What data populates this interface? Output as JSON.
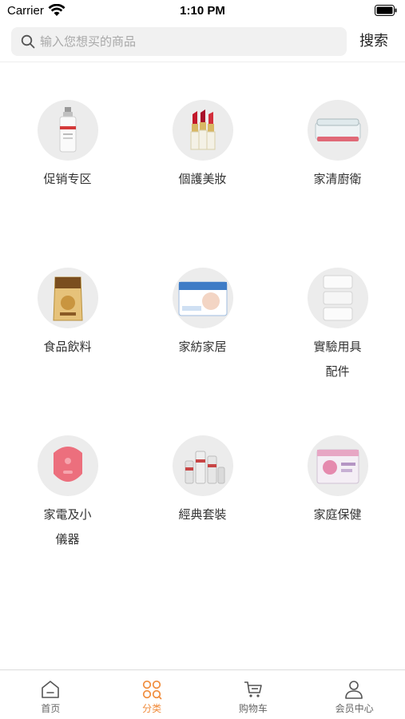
{
  "status_bar": {
    "carrier": "Carrier",
    "time": "1:10 PM"
  },
  "search": {
    "placeholder": "输入您想买的商品",
    "button_label": "搜索"
  },
  "categories": [
    {
      "label": "促销专区",
      "icon": "serum-bottle-icon"
    },
    {
      "label": "個護美妝",
      "icon": "lipstick-icon"
    },
    {
      "label": "家清廚衛",
      "icon": "storage-box-icon"
    },
    {
      "label": "食品飲料",
      "icon": "snack-bag-icon"
    },
    {
      "label": "家紡家居",
      "icon": "diaper-pack-icon"
    },
    {
      "label": "實驗用具\n配件",
      "icon": "containers-icon"
    },
    {
      "label": "家電及小\n儀器",
      "icon": "facial-cleanser-device-icon"
    },
    {
      "label": "經典套裝",
      "icon": "skincare-set-icon"
    },
    {
      "label": "家庭保健",
      "icon": "health-box-icon"
    }
  ],
  "tab_bar": {
    "tabs": [
      {
        "label": "首页",
        "icon": "home-icon"
      },
      {
        "label": "分类",
        "icon": "category-grid-icon",
        "active": true
      },
      {
        "label": "购物车",
        "icon": "cart-icon"
      },
      {
        "label": "会员中心",
        "icon": "user-icon"
      }
    ],
    "active_color": "#f08c3c"
  }
}
